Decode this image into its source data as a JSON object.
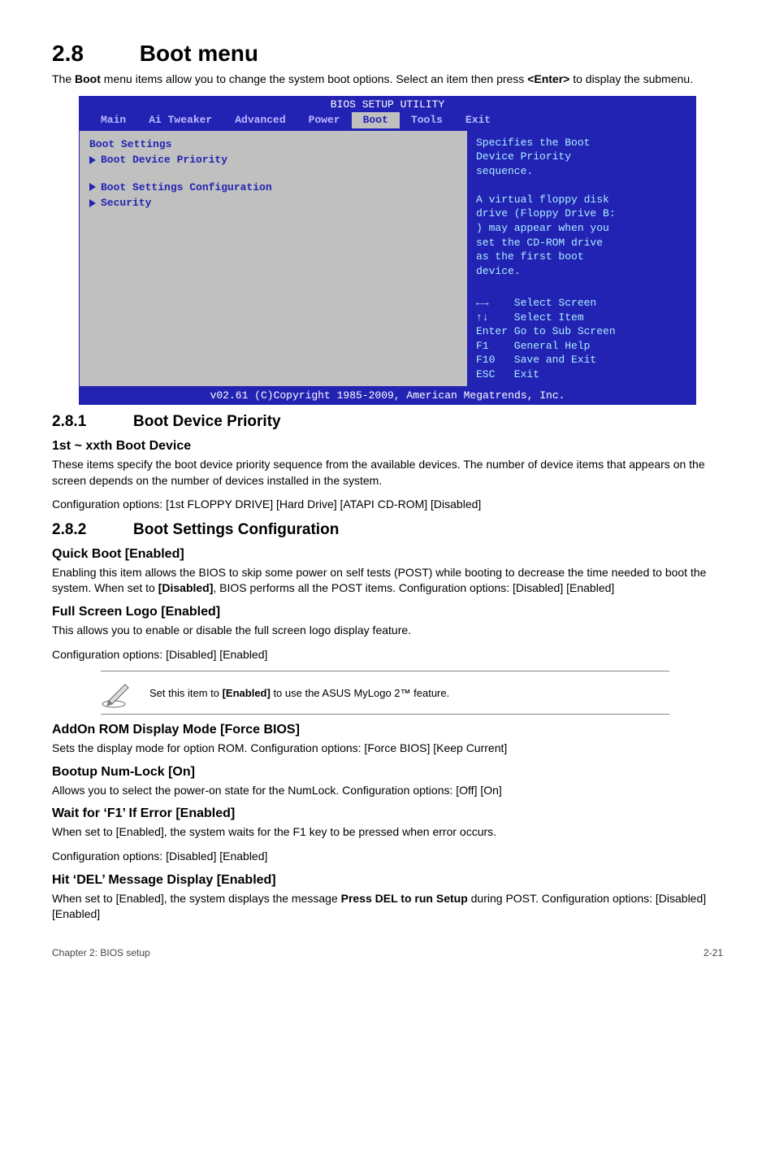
{
  "section_number": "2.8",
  "section_title": "Boot menu",
  "intro_html": "The <b>Boot</b> menu items allow you to change the system boot options. Select an item then press <b>&lt;Enter&gt;</b> to display the submenu.",
  "bios": {
    "title": "BIOS SETUP UTILITY",
    "menus": [
      "Main",
      "Ai Tweaker",
      "Advanced",
      "Power",
      "Boot",
      "Tools",
      "Exit"
    ],
    "selected_menu": "Boot",
    "left": {
      "heading": "Boot Settings",
      "items": [
        "Boot Device Priority",
        "Boot Settings Configuration",
        "Security"
      ]
    },
    "right": {
      "desc_lines": [
        "Specifies the Boot",
        "Device Priority",
        "sequence.",
        "",
        "A virtual floppy disk",
        "drive (Floppy Drive B:",
        ") may appear when you",
        "set the CD-ROM drive",
        "as the first boot",
        "device."
      ],
      "help_lines": [
        "←→    Select Screen",
        "↑↓    Select Item",
        "Enter Go to Sub Screen",
        "F1    General Help",
        "F10   Save and Exit",
        "ESC   Exit"
      ]
    },
    "copyright": "v02.61 (C)Copyright 1985-2009, American Megatrends, Inc."
  },
  "sub1": {
    "num": "2.8.1",
    "title": "Boot Device Priority",
    "h3": "1st ~ xxth Boot Device",
    "p1": "These items specify the boot device priority sequence from the available devices. The number of device items that appears on the screen depends on the number of devices installed in the system.",
    "p2": "Configuration options: [1st FLOPPY DRIVE] [Hard Drive] [ATAPI CD-ROM] [Disabled]"
  },
  "sub2": {
    "num": "2.8.2",
    "title": "Boot Settings Configuration",
    "quick": {
      "h": "Quick Boot [Enabled]",
      "p_html": "Enabling this item allows the BIOS to skip some power on self tests (POST) while booting to decrease the time needed to boot the system. When set to <b>[Disabled]</b>, BIOS performs all the POST items. Configuration options: [Disabled] [Enabled]"
    },
    "fullscreen": {
      "h": "Full Screen Logo [Enabled]",
      "p1": "This allows you to enable or disable the full screen logo display feature.",
      "p2": "Configuration options: [Disabled] [Enabled]"
    },
    "note_html": "Set this item to <b>[Enabled]</b> to use the ASUS MyLogo 2™ feature.",
    "addon": {
      "h": "AddOn ROM Display Mode [Force BIOS]",
      "p": "Sets the display mode for option ROM. Configuration options: [Force BIOS] [Keep Current]"
    },
    "numlock": {
      "h": "Bootup Num-Lock [On]",
      "p": "Allows you to select the power-on state for the NumLock. Configuration options: [Off] [On]"
    },
    "f1": {
      "h": "Wait for ‘F1’ If Error [Enabled]",
      "p1": "When set to [Enabled], the system waits for the F1 key to be pressed when error occurs.",
      "p2": "Configuration options: [Disabled] [Enabled]"
    },
    "del": {
      "h": "Hit ‘DEL’ Message Display [Enabled]",
      "p_html": "When set to [Enabled], the system displays the message <b>Press DEL to run Setup</b> during POST. Configuration options: [Disabled] [Enabled]"
    }
  },
  "footer": {
    "left": "Chapter 2: BIOS setup",
    "right": "2-21"
  }
}
